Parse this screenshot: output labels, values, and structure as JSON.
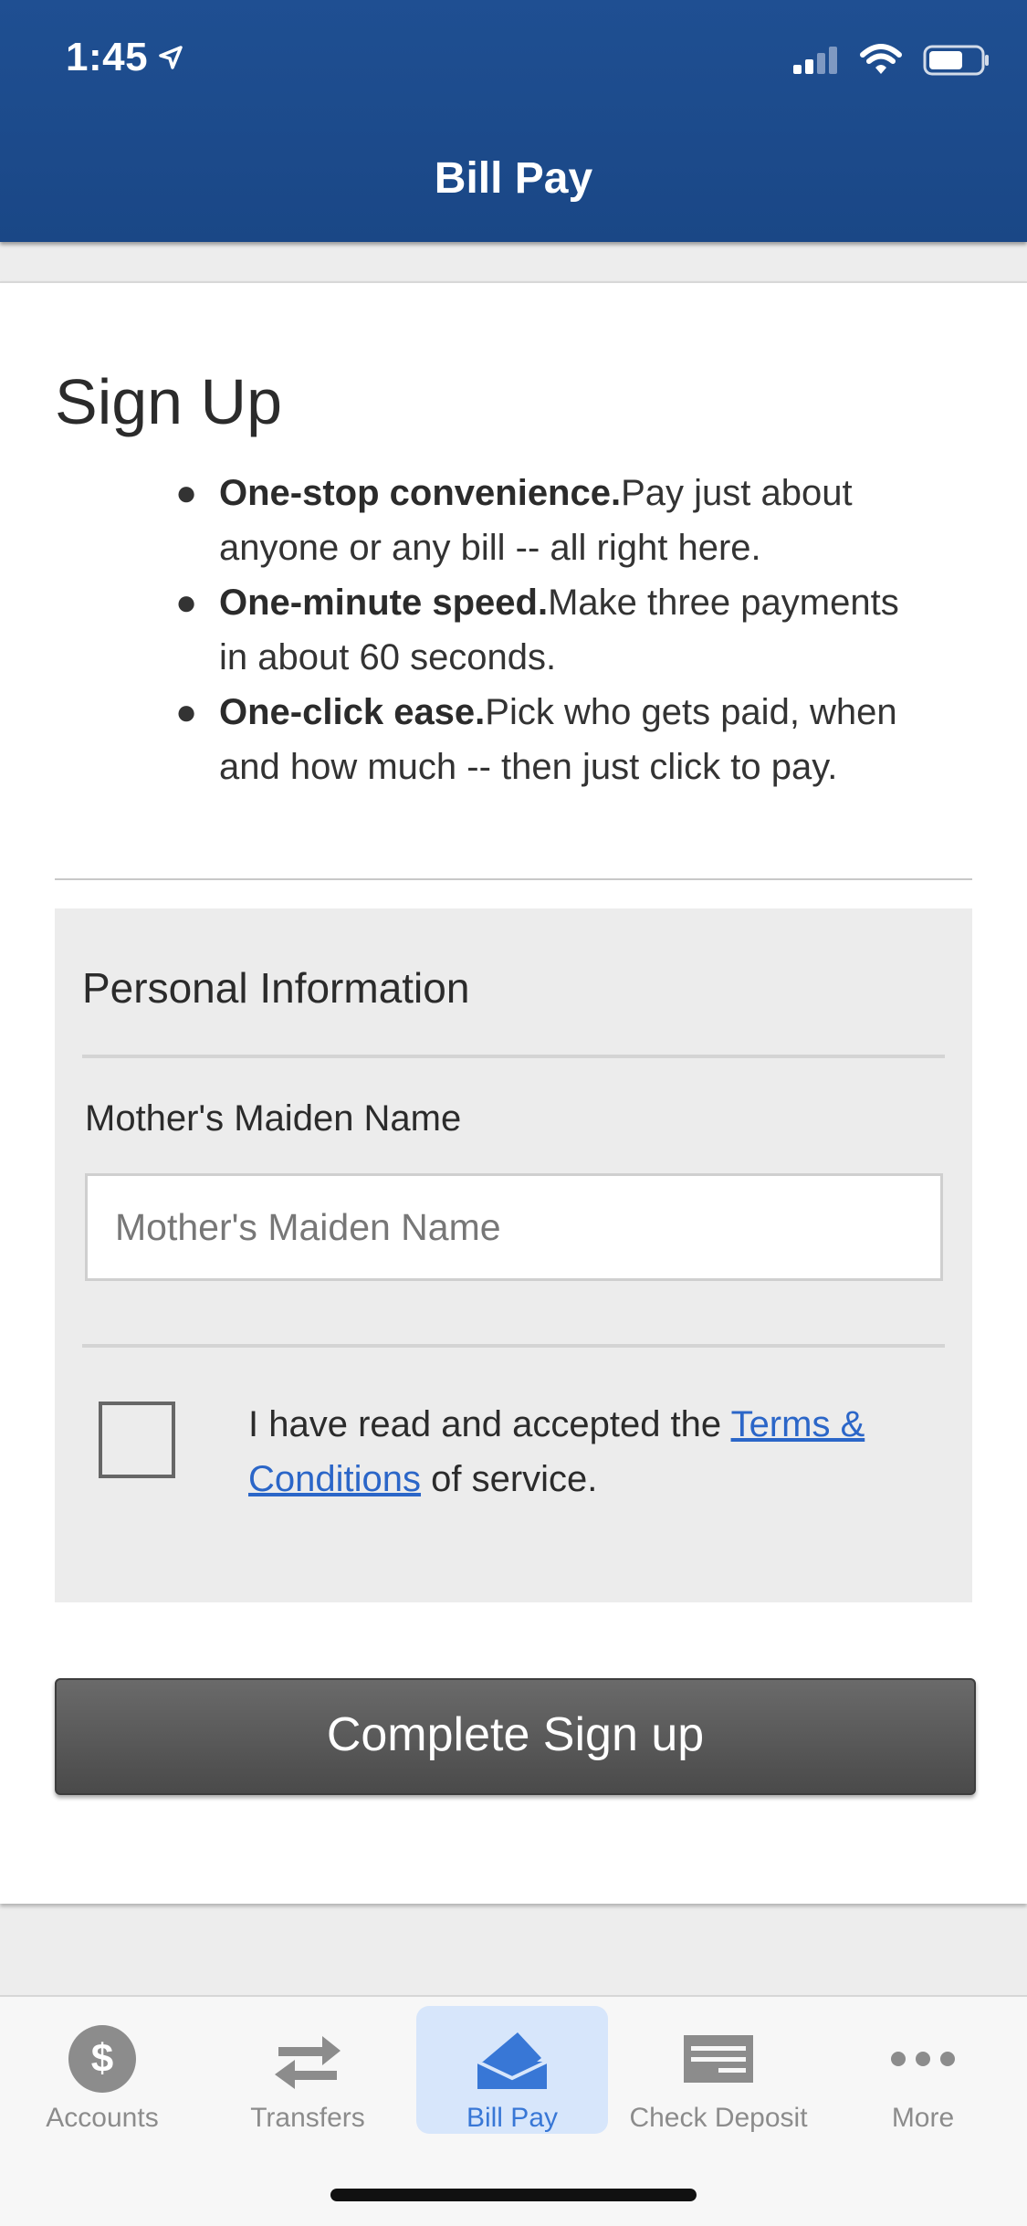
{
  "status_bar": {
    "time": "1:45"
  },
  "header": {
    "title": "Bill Pay"
  },
  "signup": {
    "title": "Sign Up",
    "benefits": [
      {
        "bold": "One-stop convenience.",
        "text": "Pay just about anyone or any bill -- all right here."
      },
      {
        "bold": "One-minute speed.",
        "text": "Make three payments in about 60 seconds."
      },
      {
        "bold": "One-click ease.",
        "text": "Pick who gets paid, when and how much -- then just click to pay."
      }
    ]
  },
  "personal_info": {
    "heading": "Personal Information",
    "maiden_label": "Mother's Maiden Name",
    "maiden_placeholder": "Mother's Maiden Name",
    "maiden_value": ""
  },
  "terms": {
    "checked": false,
    "prefix": "I have read and accepted the ",
    "link": "Terms & Conditions",
    "suffix": " of service."
  },
  "complete_button": "Complete Sign up",
  "tabs": [
    {
      "label": "Accounts",
      "icon": "dollar-icon",
      "active": false
    },
    {
      "label": "Transfers",
      "icon": "transfer-arrows-icon",
      "active": false
    },
    {
      "label": "Bill Pay",
      "icon": "bill-envelope-icon",
      "active": true
    },
    {
      "label": "Check Deposit",
      "icon": "check-icon",
      "active": false
    },
    {
      "label": "More",
      "icon": "more-dots-icon",
      "active": false
    }
  ],
  "colors": {
    "header": "#1f4f92",
    "accent": "#3877d6",
    "link": "#2b66c8",
    "button": "#555555"
  }
}
